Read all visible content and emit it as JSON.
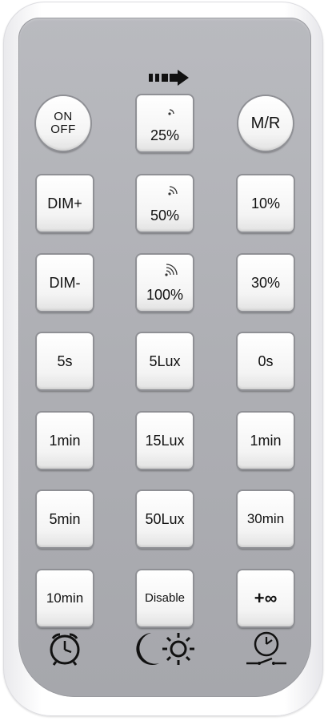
{
  "keys": {
    "on_off": "ON\nOFF",
    "sens_25": "25%",
    "mr": "M/R",
    "dim_plus": "DIM+",
    "sens_50": "50%",
    "standby_10": "10%",
    "dim_minus": "DIM-",
    "sens_100": "100%",
    "standby_30": "30%",
    "hold_5s": "5s",
    "lux_5": "5Lux",
    "standby_0s": "0s",
    "hold_1min": "1min",
    "lux_15": "15Lux",
    "standby_1min": "1min",
    "hold_5min": "5min",
    "lux_50": "50Lux",
    "standby_30min": "30min",
    "hold_10min": "10min",
    "lux_disable": "Disable",
    "standby_inf": "+∞"
  },
  "icons": {
    "top": "arrow-right-icon",
    "bottom_left": "clock-icon",
    "bottom_center": "moon-sun-icon",
    "bottom_right": "switch-timer-icon"
  },
  "colors": {
    "panel": "#b0b1b6",
    "key": "#f4f4f4",
    "text": "#111111"
  }
}
